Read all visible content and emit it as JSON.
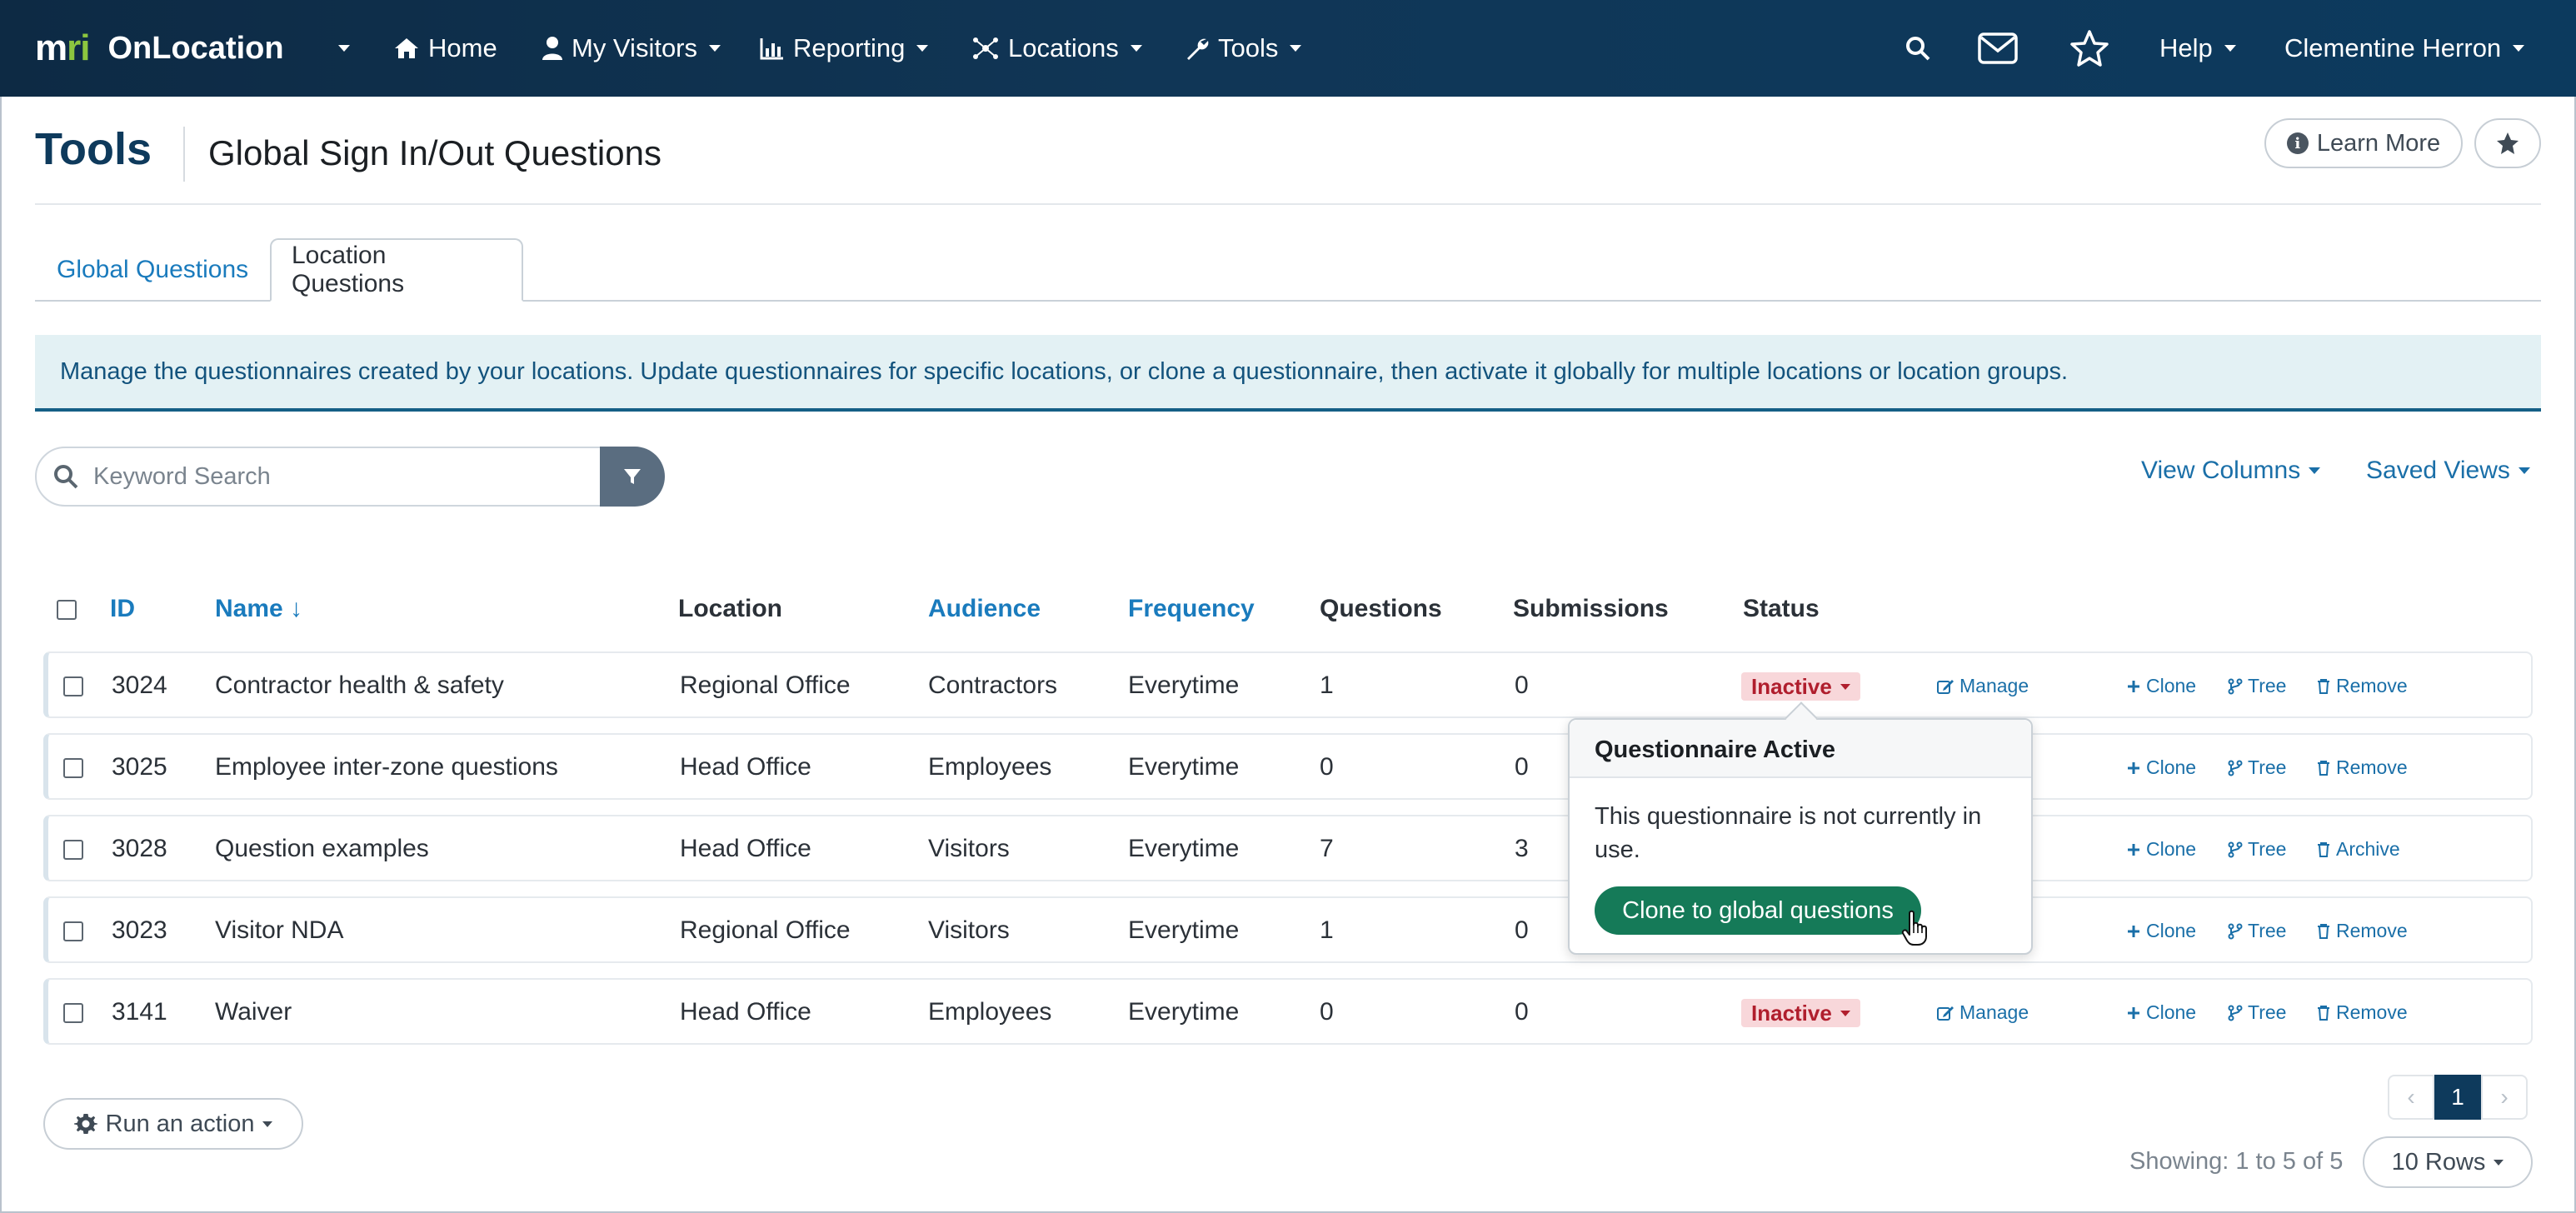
{
  "navbar": {
    "brand_logo_prefix": "m",
    "brand_logo_accent": "ri",
    "brand_name": "OnLocation",
    "items": [
      {
        "label": "Home",
        "icon": "home-icon"
      },
      {
        "label": "My Visitors",
        "icon": "user-icon"
      },
      {
        "label": "Reporting",
        "icon": "chart-icon"
      },
      {
        "label": "Locations",
        "icon": "network-icon"
      },
      {
        "label": "Tools",
        "icon": "wrench-icon"
      }
    ],
    "help_label": "Help",
    "user_name": "Clementine Herron"
  },
  "header": {
    "title": "Tools",
    "subtitle": "Global Sign In/Out Questions",
    "learn_more_label": "Learn More"
  },
  "tabs": [
    {
      "label": "Global Questions",
      "active": false
    },
    {
      "label": "Location Questions",
      "active": true
    }
  ],
  "alert": {
    "text": "Manage the questionnaires created by your locations. Update questionnaires for specific locations, or clone a questionnaire, then activate it globally for multiple locations or location groups."
  },
  "search": {
    "placeholder": "Keyword Search"
  },
  "toolbar": {
    "view_columns_label": "View Columns",
    "saved_views_label": "Saved Views"
  },
  "table": {
    "columns": {
      "id": "ID",
      "name": "Name ↓",
      "location": "Location",
      "audience": "Audience",
      "frequency": "Frequency",
      "questions": "Questions",
      "submissions": "Submissions",
      "status": "Status"
    },
    "rows": [
      {
        "id": "3024",
        "name": "Contractor health & safety",
        "location": "Regional Office",
        "audience": "Contractors",
        "frequency": "Everytime",
        "questions": "1",
        "submissions": "0",
        "status": "Inactive",
        "manage": "Manage",
        "clone": "Clone",
        "tree": "Tree",
        "last_action": "Remove"
      },
      {
        "id": "3025",
        "name": "Employee inter-zone questions",
        "location": "Head Office",
        "audience": "Employees",
        "frequency": "Everytime",
        "questions": "0",
        "submissions": "0",
        "status": "",
        "manage": "",
        "clone": "Clone",
        "tree": "Tree",
        "last_action": "Remove"
      },
      {
        "id": "3028",
        "name": "Question examples",
        "location": "Head Office",
        "audience": "Visitors",
        "frequency": "Everytime",
        "questions": "7",
        "submissions": "3",
        "status": "",
        "manage": "",
        "clone": "Clone",
        "tree": "Tree",
        "last_action": "Archive"
      },
      {
        "id": "3023",
        "name": "Visitor NDA",
        "location": "Regional Office",
        "audience": "Visitors",
        "frequency": "Everytime",
        "questions": "1",
        "submissions": "0",
        "status": "",
        "manage": "",
        "clone": "Clone",
        "tree": "Tree",
        "last_action": "Remove"
      },
      {
        "id": "3141",
        "name": "Waiver",
        "location": "Head Office",
        "audience": "Employees",
        "frequency": "Everytime",
        "questions": "0",
        "submissions": "0",
        "status": "Inactive",
        "manage": "Manage",
        "clone": "Clone",
        "tree": "Tree",
        "last_action": "Remove"
      }
    ]
  },
  "popover": {
    "title": "Questionnaire Active",
    "body": "This questionnaire is not currently in use.",
    "button_label": "Clone to global questions"
  },
  "footer": {
    "run_action_label": "Run an action",
    "current_page": "1",
    "showing_text": "Showing: 1 to 5 of 5",
    "rows_label": "10 Rows"
  },
  "colors": {
    "navbar": "#0d2a44",
    "link": "#1a7bbd",
    "inactive_badge_bg": "#f8d7da",
    "inactive_badge_text": "#b01e2d",
    "clone_button": "#157a58",
    "alert_bg": "#e3f1f4"
  }
}
